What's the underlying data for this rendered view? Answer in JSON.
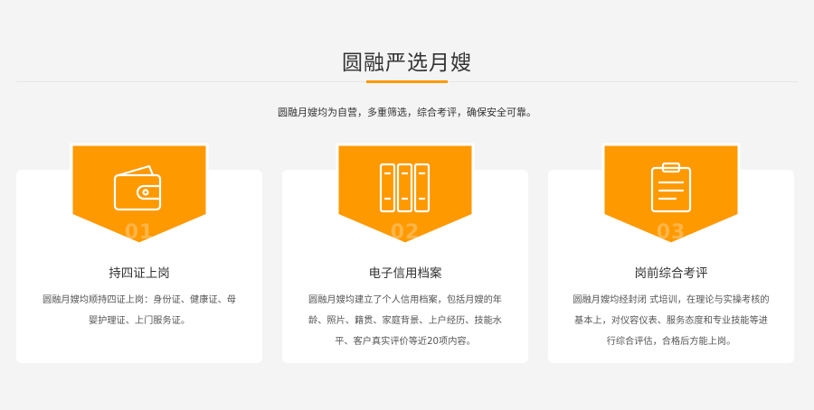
{
  "header": {
    "title": "圆融严选月嫂",
    "subtitle": "圆融月嫂均为自营，多重筛选，综合考评，确保安全可靠。"
  },
  "colors": {
    "accent": "#ff9900",
    "card_bg": "#ffffff",
    "page_bg": "#f4f4f4"
  },
  "cards": [
    {
      "number": "01",
      "icon": "wallet-icon",
      "title": "持四证上岗",
      "description": "圆融月嫂均顺持四证上岗：身份证、健康证、母婴护理证、上门服务证。"
    },
    {
      "number": "02",
      "icon": "binders-icon",
      "title": "电子信用档案",
      "description": "圆融月嫂均建立了个人信用档案，包括月嫂的年龄、照片、籍贯、家庭背景、上户经历、技能水平、客户真实评价等近20项内容。"
    },
    {
      "number": "03",
      "icon": "clipboard-icon",
      "title": "岗前综合考评",
      "description": "圆融月嫂均经封闭 式培训，在理论与实操考核的基本上，对仪容仪表、服务态度和专业技能等进行综合评估，合格后方能上岗。"
    }
  ]
}
